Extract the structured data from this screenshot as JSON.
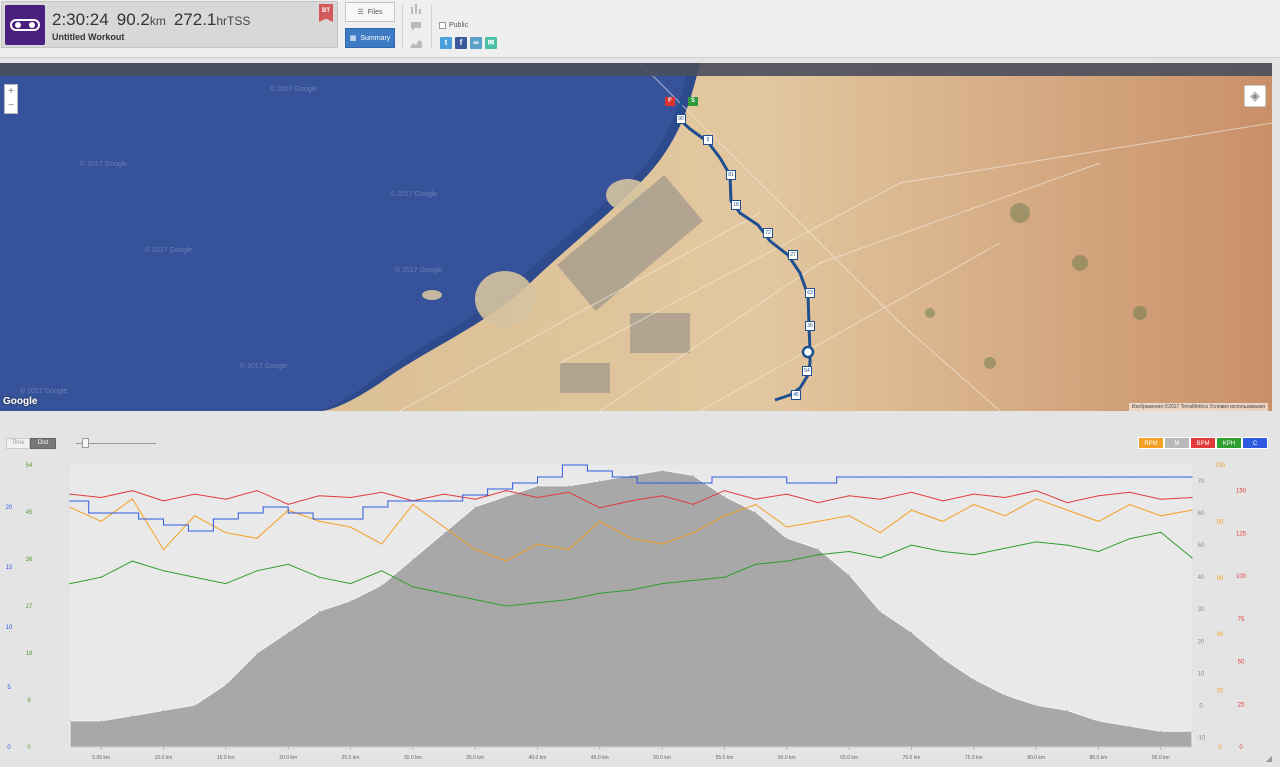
{
  "header": {
    "stats": [
      {
        "value": "2:30:24",
        "unit": ""
      },
      {
        "value": "90.2",
        "unit": "km"
      },
      {
        "value": "272.1",
        "unit": "hrTSS"
      }
    ],
    "workout_name": "Untitled Workout",
    "badge": "BT",
    "files_label": "Files",
    "summary_label": "Summary",
    "public_label": "Public"
  },
  "share_icons": [
    {
      "name": "twitter-icon",
      "glyph": "t",
      "color": "#4a9fd8"
    },
    {
      "name": "facebook-icon",
      "glyph": "f",
      "color": "#3b5b9a"
    },
    {
      "name": "link-icon",
      "glyph": "∞",
      "color": "#5aa0c8"
    },
    {
      "name": "email-icon",
      "glyph": "✉",
      "color": "#4cc0a4"
    }
  ],
  "map": {
    "google_logo": "Google",
    "attribution": "Изображения ©2017 TerraMetrics   Условия использования",
    "watermarks": [
      "© 2017 Google",
      "© 2017 Google",
      "© 2017 Google",
      "© 2017 Google",
      "© 2017 Google",
      "© 2017 Google",
      "© 2017 Google"
    ],
    "start_marker": "S",
    "finish_marker": "F",
    "km_markers": [
      "90",
      "9",
      "81",
      "18",
      "72",
      "27",
      "63",
      "36",
      "54",
      "45"
    ],
    "colors": {
      "route": "#1f4f8f",
      "water": "#2b4a8a",
      "desert": "#dcbf97"
    }
  },
  "chart": {
    "x_mode_tabs": [
      "Time",
      "Dist"
    ],
    "legend": [
      {
        "label": "RPM",
        "color": "#f3a024"
      },
      {
        "label": "M",
        "color": "#b9b9b9"
      },
      {
        "label": "BPM",
        "color": "#e23b3b"
      },
      {
        "label": "KPH",
        "color": "#2f9f2f"
      },
      {
        "label": "C",
        "color": "#2f5be0"
      }
    ]
  },
  "chart_data": {
    "type": "area",
    "x_axis": {
      "unit": "km",
      "range": [
        2.5,
        92.5
      ],
      "ticks": [
        "5.00 km",
        "10.0 km",
        "15.0 km",
        "20.0 km",
        "25.0 km",
        "30.0 km",
        "35.0 km",
        "40.0 km",
        "45.0 km",
        "50.0 km",
        "55.0 km",
        "60.0 km",
        "65.0 km",
        "70.0 km",
        "75.0 km",
        "80.0 km",
        "85.0 km",
        "90.0 km"
      ]
    },
    "y_axes": [
      {
        "id": "elevation",
        "side": "left-outer",
        "color": "#5a9a3a",
        "ticks": [
          "0",
          "9",
          "18",
          "27",
          "36",
          "45",
          "54"
        ],
        "range": [
          0,
          54
        ]
      },
      {
        "id": "c",
        "side": "left-inner",
        "color": "#2f5be0",
        "ticks": [
          "0",
          "5",
          "10",
          "15",
          "20"
        ],
        "range": [
          0,
          23.5
        ]
      },
      {
        "id": "kph",
        "side": "right-inner",
        "color": "#8a8a8a",
        "ticks": [
          "-10",
          "0",
          "10",
          "20",
          "30",
          "40",
          "50",
          "60",
          "70"
        ],
        "range": [
          -13,
          75
        ]
      },
      {
        "id": "rpm",
        "side": "right-mid",
        "color": "#f3a024",
        "ticks": [
          "0",
          "20",
          "40",
          "60",
          "80",
          "100"
        ],
        "range": [
          0,
          100
        ]
      },
      {
        "id": "bpm",
        "side": "right-outer",
        "color": "#e23b3b",
        "ticks": [
          "0",
          "25",
          "50",
          "75",
          "100",
          "125",
          "150"
        ],
        "range": [
          0,
          165
        ]
      }
    ],
    "series": [
      {
        "name": "M",
        "type": "area",
        "color": "#a8a8a8",
        "axis": "elevation",
        "x": [
          2.5,
          5,
          7.5,
          10,
          12.5,
          15,
          17.5,
          20,
          22.5,
          25,
          27.5,
          30,
          32.5,
          35,
          37.5,
          40,
          42.5,
          45,
          47.5,
          50,
          52.5,
          55,
          57.5,
          60,
          62.5,
          65,
          67.5,
          70,
          72.5,
          75,
          77.5,
          80,
          82.5,
          85,
          87.5,
          90,
          92.5
        ],
        "values": [
          5,
          5,
          6,
          7,
          8,
          12,
          18,
          22,
          26,
          28,
          31,
          36,
          41,
          46,
          48,
          50,
          50,
          51,
          52,
          53,
          52,
          48,
          45,
          40,
          38,
          33,
          26,
          22,
          17,
          13,
          10,
          8,
          7,
          5,
          4,
          3,
          3
        ]
      },
      {
        "name": "BPM",
        "type": "line",
        "color": "#e23b3b",
        "axis": "bpm",
        "x": [
          2.5,
          5,
          7.5,
          10,
          12.5,
          15,
          17.5,
          20,
          22.5,
          25,
          27.5,
          30,
          32.5,
          35,
          37.5,
          40,
          42.5,
          45,
          47.5,
          50,
          52.5,
          55,
          57.5,
          60,
          62.5,
          65,
          67.5,
          70,
          72.5,
          75,
          77.5,
          80,
          82.5,
          85,
          87.5,
          90,
          92.5
        ],
        "values": [
          148,
          146,
          150,
          144,
          148,
          145,
          150,
          142,
          147,
          146,
          149,
          144,
          148,
          145,
          150,
          146,
          149,
          140,
          144,
          147,
          142,
          150,
          145,
          148,
          143,
          147,
          145,
          149,
          144,
          148,
          146,
          150,
          143,
          147,
          149,
          145,
          146
        ]
      },
      {
        "name": "RPM",
        "type": "line",
        "color": "#f3a024",
        "axis": "rpm",
        "x": [
          2.5,
          5,
          7.5,
          10,
          12.5,
          15,
          17.5,
          20,
          22.5,
          25,
          27.5,
          30,
          32.5,
          35,
          37.5,
          40,
          42.5,
          45,
          47.5,
          50,
          52.5,
          55,
          57.5,
          60,
          62.5,
          65,
          67.5,
          70,
          72.5,
          75,
          77.5,
          80,
          82.5,
          85,
          87.5,
          90,
          92.5
        ],
        "values": [
          85,
          80,
          88,
          70,
          82,
          76,
          74,
          84,
          80,
          78,
          72,
          86,
          78,
          70,
          66,
          72,
          70,
          80,
          74,
          72,
          76,
          82,
          86,
          78,
          80,
          82,
          76,
          84,
          80,
          86,
          82,
          88,
          84,
          80,
          86,
          82,
          84
        ]
      },
      {
        "name": "KPH",
        "type": "line",
        "color": "#2f9f2f",
        "axis": "kph",
        "x": [
          2.5,
          5,
          7.5,
          10,
          12.5,
          15,
          17.5,
          20,
          22.5,
          25,
          27.5,
          30,
          32.5,
          35,
          37.5,
          40,
          42.5,
          45,
          47.5,
          50,
          52.5,
          55,
          57.5,
          60,
          62.5,
          65,
          67.5,
          70,
          72.5,
          75,
          77.5,
          80,
          82.5,
          85,
          87.5,
          90,
          92.5
        ],
        "values": [
          38,
          40,
          45,
          42,
          40,
          38,
          42,
          44,
          40,
          38,
          42,
          37,
          35,
          33,
          31,
          32,
          33,
          35,
          36,
          38,
          39,
          40,
          44,
          45,
          47,
          48,
          46,
          50,
          48,
          47,
          49,
          51,
          50,
          48,
          52,
          54,
          46
        ]
      },
      {
        "name": "C",
        "type": "step",
        "color": "#2f5be0",
        "axis": "c",
        "x": [
          2.5,
          4,
          6,
          8,
          10,
          12,
          14,
          16,
          18,
          20,
          22,
          24,
          26,
          28,
          30,
          32,
          34,
          36,
          38,
          40,
          42,
          44,
          46,
          48,
          50,
          52,
          54,
          56,
          58,
          60,
          62,
          64,
          66,
          68,
          70,
          72,
          74,
          76,
          78,
          80,
          82,
          84,
          86,
          88,
          90,
          92.5
        ],
        "values": [
          20.5,
          19.5,
          19.5,
          19,
          18.5,
          18,
          19,
          19.5,
          20,
          19.5,
          19,
          19,
          20,
          20.5,
          20.5,
          20.5,
          21,
          21.5,
          22,
          22.5,
          23.5,
          23,
          22.5,
          22,
          22,
          22,
          22.5,
          22.5,
          22.5,
          22,
          22,
          22.5,
          22.5,
          22.5,
          22.5,
          22.5,
          22.5,
          22.5,
          22.5,
          22.5,
          22.5,
          22.5,
          22.5,
          22.5,
          22.5,
          22.5
        ]
      }
    ]
  }
}
